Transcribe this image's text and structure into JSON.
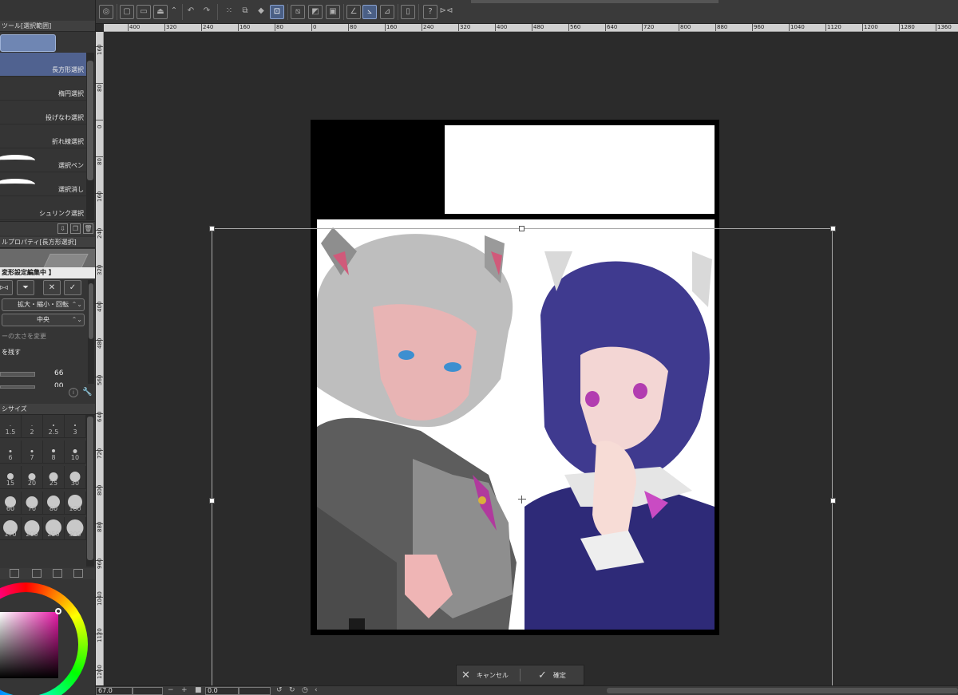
{
  "subtool": {
    "header": "ツール[選択範囲]",
    "items": [
      {
        "label": "長方形選択",
        "active": true
      },
      {
        "label": "楕円選択",
        "active": false
      },
      {
        "label": "投げなわ選択",
        "active": false
      },
      {
        "label": "折れ線選択",
        "active": false
      },
      {
        "label": "選択ペン",
        "active": false
      },
      {
        "label": "選択消し",
        "active": false
      },
      {
        "label": "シュリンク選択",
        "active": false
      }
    ]
  },
  "tool_property": {
    "header": "ルプロパティ[長方形選択]",
    "mode_label": "変形設定編集中 】",
    "transform_mode": "拡大・縮小・回転",
    "reference_point": "中央",
    "line_width_option": "ーの太さを変更",
    "keep_option": "を残す",
    "value_1": "66",
    "value_2": "00"
  },
  "brush_size": {
    "header": "シサイズ",
    "sizes": [
      "1.5",
      "2",
      "2.5",
      "3",
      "6",
      "7",
      "8",
      "10",
      "15",
      "20",
      "25",
      "30",
      "17",
      "60",
      "70",
      "80",
      "100",
      "170",
      "200",
      "250",
      "300"
    ]
  },
  "ruler": {
    "horizontal": [
      "400",
      "320",
      "240",
      "160",
      "80",
      "0",
      "80",
      "160",
      "240",
      "320",
      "400",
      "480",
      "560",
      "640",
      "720",
      "800",
      "880",
      "960",
      "1040",
      "1120",
      "1200",
      "1280",
      "1360"
    ],
    "vertical": [
      "160",
      "80",
      "0",
      "80",
      "160",
      "240",
      "320",
      "400",
      "480",
      "560",
      "640",
      "720",
      "800",
      "880",
      "960",
      "1040",
      "1120",
      "1200"
    ]
  },
  "confirm": {
    "cancel_label": "キャンセル",
    "ok_label": "確定"
  },
  "status": {
    "zoom": "67.0",
    "angle": "0.0"
  },
  "colors": {
    "accent": "#506290",
    "panel": "#353535",
    "canvas_bg": "#2b2b2b"
  }
}
